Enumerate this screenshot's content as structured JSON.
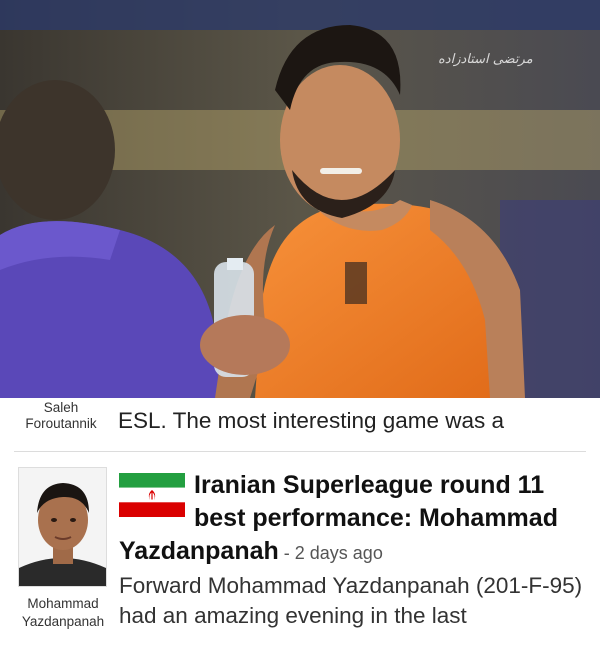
{
  "hero": {
    "watermark": "مرتضی استادزاده"
  },
  "previous_item": {
    "author_first": "Saleh",
    "author_last": "Foroutannik",
    "snippet": "ESL. The most interesting game was a"
  },
  "article": {
    "flag_icon": "iran-flag-icon",
    "headline": "Iranian Superleague round 11 best performance: Mohammad",
    "headline_name": "Yazdanpanah",
    "date": " - 2 days ago",
    "snippet": "Forward Mohammad Yazdanpanah (201-F-95) had an amazing evening in the last",
    "author_first": "Mohammad",
    "author_last": "Yazdanpanah"
  },
  "colors": {
    "jersey": "#f07a24",
    "flag_green": "#239f40",
    "flag_red": "#da0000"
  }
}
